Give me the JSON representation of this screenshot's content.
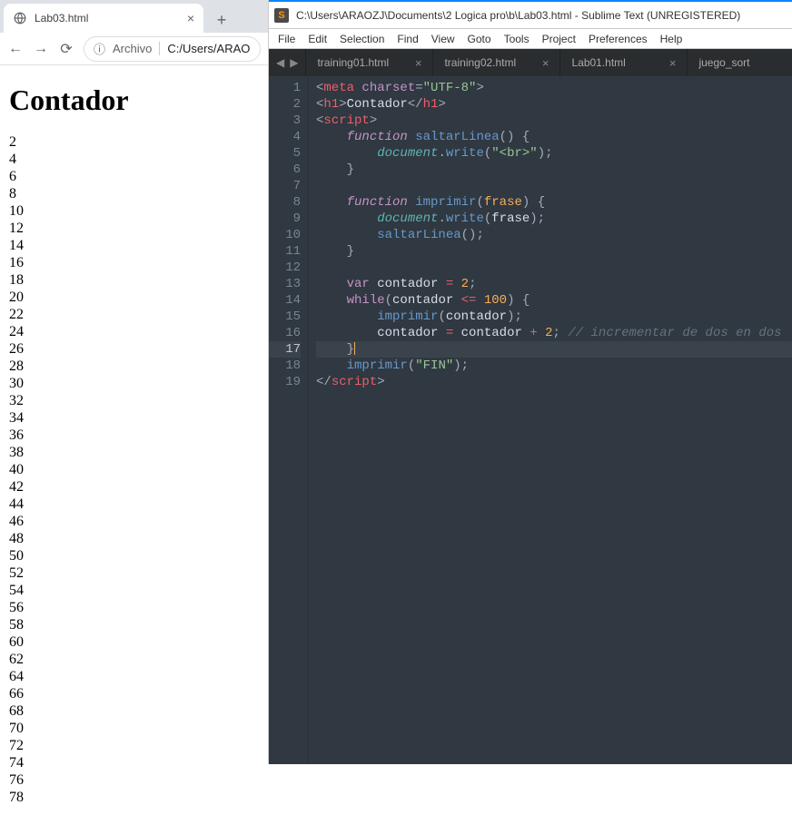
{
  "browser": {
    "tab_title": "Lab03.html",
    "archivo_label": "Archivo",
    "url": "C:/Users/ARAO",
    "page_heading": "Contador",
    "values": [
      "2",
      "4",
      "6",
      "8",
      "10",
      "12",
      "14",
      "16",
      "18",
      "20",
      "22",
      "24",
      "26",
      "28",
      "30",
      "32",
      "34",
      "36",
      "38",
      "40",
      "42",
      "44",
      "46",
      "48",
      "50",
      "52",
      "54",
      "56",
      "58",
      "60",
      "62",
      "64",
      "66",
      "68",
      "70",
      "72",
      "74",
      "76",
      "78"
    ]
  },
  "sublime": {
    "window_title": "C:\\Users\\ARAOZJ\\Documents\\2 Logica pro\\b\\Lab03.html - Sublime Text (UNREGISTERED)",
    "menu": [
      "File",
      "Edit",
      "Selection",
      "Find",
      "View",
      "Goto",
      "Tools",
      "Project",
      "Preferences",
      "Help"
    ],
    "tabs": [
      {
        "label": "training01.html",
        "active": false
      },
      {
        "label": "training02.html",
        "active": false
      },
      {
        "label": "Lab01.html",
        "active": false
      },
      {
        "label": "juego_sort",
        "active": false,
        "partial": true
      }
    ],
    "line_count": 19,
    "highlight_line": 17,
    "code": {
      "l1": {
        "meta": "meta",
        "charset_attr": "charset",
        "charset_val": "\"UTF-8\""
      },
      "l2": {
        "h1": "h1",
        "text": "Contador"
      },
      "l3": {
        "script": "script"
      },
      "l4": {
        "function": "function",
        "name": "saltarLinea"
      },
      "l5": {
        "obj": "document",
        "method": "write",
        "arg": "\"<br>\""
      },
      "l7": {},
      "l8": {
        "function": "function",
        "name": "imprimir",
        "param": "frase"
      },
      "l9": {
        "obj": "document",
        "method": "write",
        "arg": "frase"
      },
      "l10": {
        "call": "saltarLinea"
      },
      "l13": {
        "var": "var",
        "name": "contador",
        "val": "2"
      },
      "l14": {
        "while": "while",
        "name": "contador",
        "op": "<=",
        "limit": "100"
      },
      "l15": {
        "call": "imprimir",
        "arg": "contador"
      },
      "l16": {
        "name": "contador",
        "name2": "contador",
        "plus": "+",
        "two": "2",
        "comment": "// incrementar de dos en dos"
      },
      "l18": {
        "call": "imprimir",
        "arg": "\"FIN\""
      }
    }
  }
}
